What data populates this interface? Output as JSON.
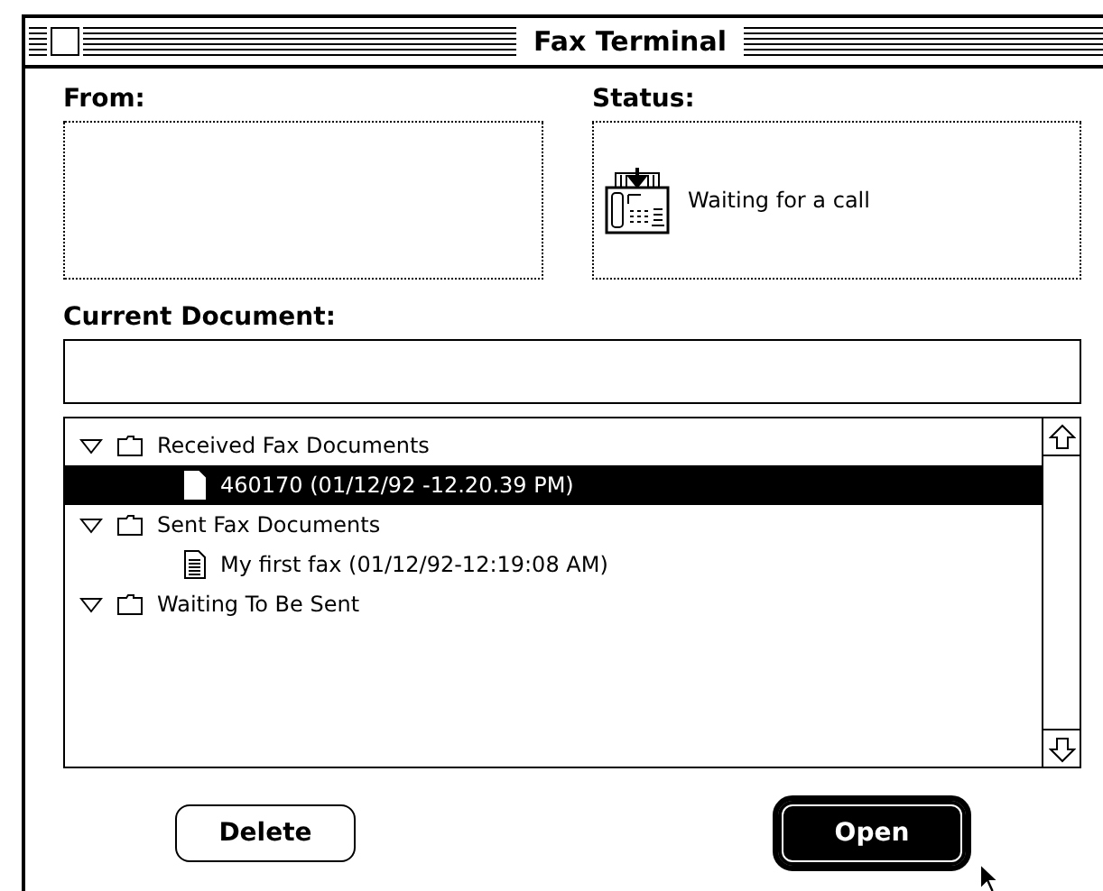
{
  "window": {
    "title": "Fax Terminal"
  },
  "from": {
    "label": "From:"
  },
  "status": {
    "label": "Status:",
    "text": "Waiting for a call"
  },
  "current_document": {
    "label": "Current Document:"
  },
  "documents": [
    {
      "kind": "folder",
      "label": "Received Fax Documents",
      "expanded": true,
      "selected": false,
      "children": [
        {
          "kind": "blank",
          "label": "460170  (01/12/92 -12.20.39 PM)",
          "selected": true
        }
      ]
    },
    {
      "kind": "folder",
      "label": "Sent Fax Documents",
      "expanded": true,
      "selected": false,
      "children": [
        {
          "kind": "text",
          "label": "My first fax (01/12/92-12:19:08 AM)",
          "selected": false
        }
      ]
    },
    {
      "kind": "folder",
      "label": "Waiting To Be Sent",
      "expanded": true,
      "selected": false
    }
  ],
  "buttons": [
    {
      "label": "Delete",
      "default": false,
      "pressed": false
    },
    {
      "label": "Open",
      "default": true,
      "pressed": true
    }
  ]
}
